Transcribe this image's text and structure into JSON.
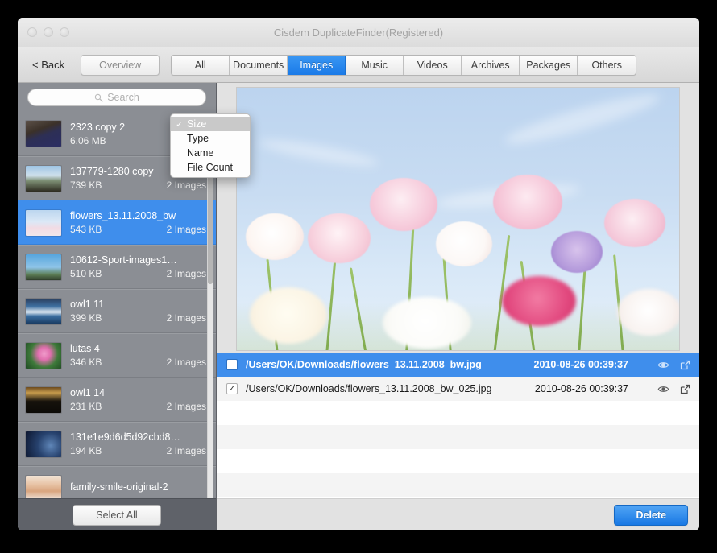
{
  "window": {
    "title": "Cisdem DuplicateFinder(Registered)",
    "lights": [
      "close-button",
      "minimize-button",
      "zoom-button"
    ]
  },
  "toolbar": {
    "back_label": "< Back",
    "overview_label": "Overview",
    "tabs": [
      {
        "label": "All",
        "active": false
      },
      {
        "label": "Documents",
        "active": false
      },
      {
        "label": "Images",
        "active": true
      },
      {
        "label": "Music",
        "active": false
      },
      {
        "label": "Videos",
        "active": false
      },
      {
        "label": "Archives",
        "active": false
      },
      {
        "label": "Packages",
        "active": false
      },
      {
        "label": "Others",
        "active": false
      }
    ],
    "accent_color": "#1a7ae8"
  },
  "sort_menu": {
    "visible": true,
    "items": [
      {
        "label": "Size",
        "checked": true
      },
      {
        "label": "Type",
        "checked": false
      },
      {
        "label": "Name",
        "checked": false
      },
      {
        "label": "File Count",
        "checked": false
      }
    ],
    "check_glyph": "✓"
  },
  "sidebar": {
    "search": {
      "placeholder": "Search",
      "value": "",
      "icon": "search-icon"
    },
    "select_all_label": "Select All",
    "items": [
      {
        "name": "2323 copy 2",
        "size": "6.06 MB",
        "count": "",
        "selected": false
      },
      {
        "name": "137779-1280 copy",
        "size": "739 KB",
        "count": "2 Images",
        "selected": false
      },
      {
        "name": "flowers_13.11.2008_bw",
        "size": "543 KB",
        "count": "2 Images",
        "selected": true
      },
      {
        "name": "10612-Sport-images1…",
        "size": "510 KB",
        "count": "2 Images",
        "selected": false
      },
      {
        "name": "owl1 11",
        "size": "399 KB",
        "count": "2 Images",
        "selected": false
      },
      {
        "name": "lutas 4",
        "size": "346 KB",
        "count": "2 Images",
        "selected": false
      },
      {
        "name": "owl1 14",
        "size": "231 KB",
        "count": "2 Images",
        "selected": false
      },
      {
        "name": "131e1e9d6d5d92cbd8…",
        "size": "194 KB",
        "count": "2 Images",
        "selected": false
      },
      {
        "name": "family-smile-original-2",
        "size": "",
        "count": "",
        "selected": false
      }
    ]
  },
  "main": {
    "preview": {
      "alt": "flowers_13.11.2008_bw preview"
    },
    "files": [
      {
        "path": "/Users/OK/Downloads/flowers_13.11.2008_bw.jpg",
        "timestamp": "2010-08-26 00:39:37",
        "checked": false,
        "selected": true
      },
      {
        "path": "/Users/OK/Downloads/flowers_13.11.2008_bw_025.jpg",
        "timestamp": "2010-08-26 00:39:37",
        "checked": true,
        "selected": false
      }
    ],
    "empty_row_count": 5,
    "check_glyph": "✓",
    "row_icons": [
      "eye-icon",
      "open-external-icon"
    ]
  },
  "bottom": {
    "delete_label": "Delete",
    "delete_color": "#1878e4"
  }
}
